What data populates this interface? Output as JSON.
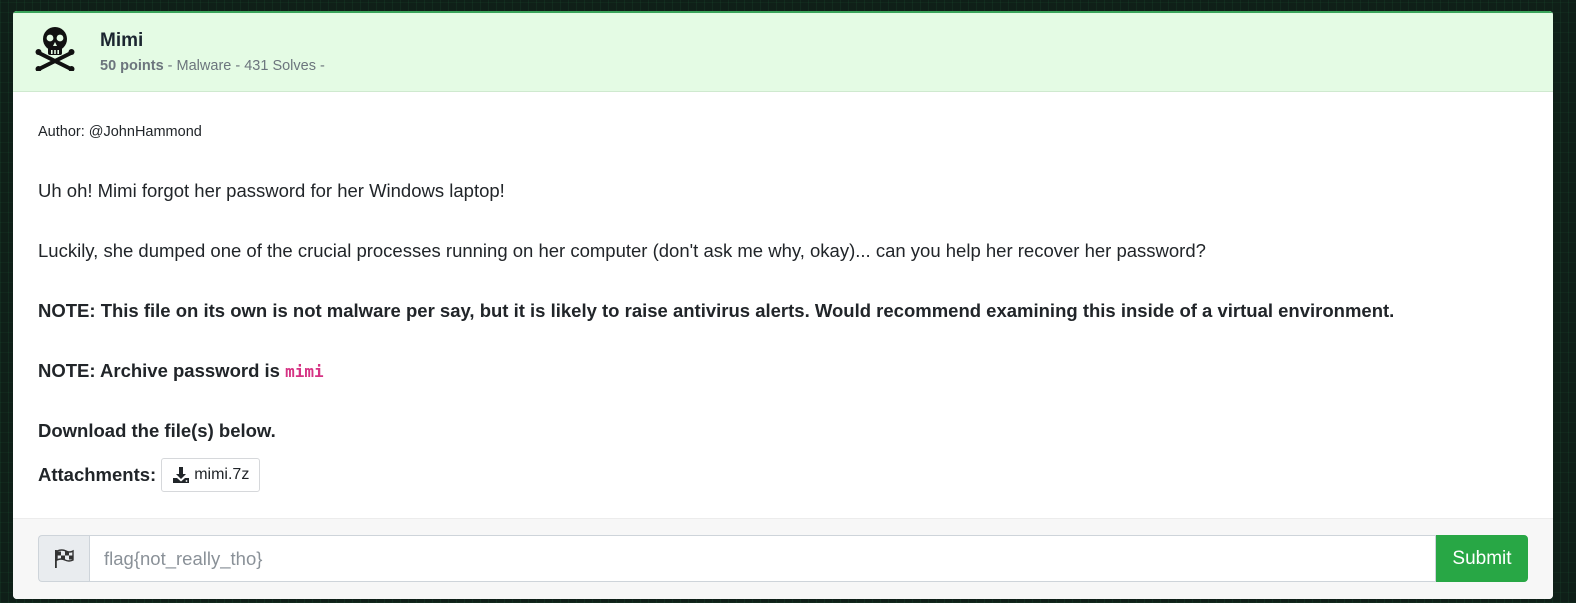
{
  "challenge": {
    "icon": "skull-crossbones-icon",
    "name": "Mimi",
    "points": "50 points",
    "meta_rest": " - Malware - 431 Solves -",
    "author": "Author: @JohnHammond",
    "description": {
      "p1": "Uh oh! Mimi forgot her password for her Windows laptop!",
      "p2": "Luckily, she dumped one of the crucial processes running on her computer (don't ask me why, okay)... can you help her recover her password?",
      "p3": "NOTE: This file on its own is not malware per say, but it is likely to raise antivirus alerts. Would recommend examining this inside of a virtual environment.",
      "p4_prefix": "NOTE: Archive password is ",
      "p4_code": "mimi",
      "p5": "Download the file(s) below."
    },
    "attachments_label": "Attachments:",
    "attachments": [
      {
        "icon": "download-icon",
        "name": "mimi.7z"
      }
    ]
  },
  "submission": {
    "prefix_icon": "checkered-flag-icon",
    "placeholder": "flag{not_really_tho}",
    "value": "",
    "submit_label": "Submit"
  },
  "colors": {
    "header_bg": "#e4fbe4",
    "submit_bg": "#28a745",
    "code_color": "#d63384"
  }
}
